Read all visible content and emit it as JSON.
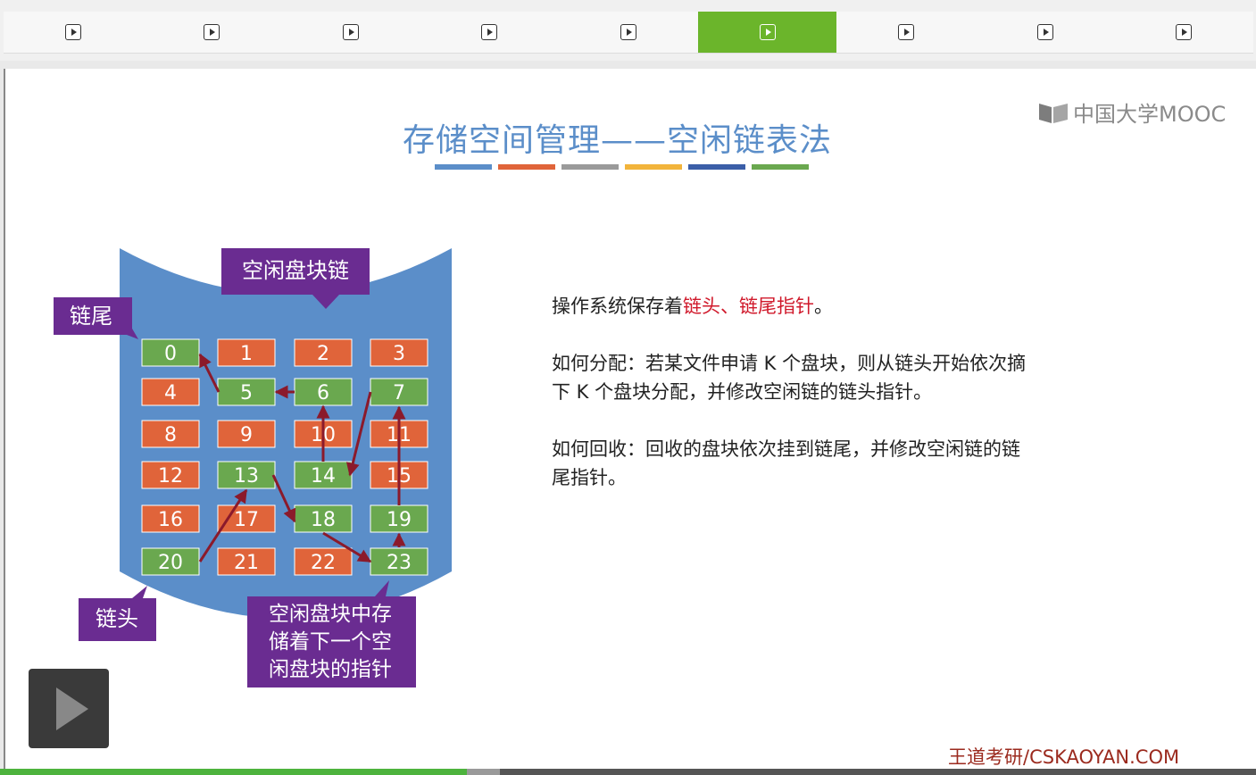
{
  "tabs": [
    {
      "icon": "play-icon",
      "active": false
    },
    {
      "icon": "play-icon",
      "active": false
    },
    {
      "icon": "play-icon",
      "active": false
    },
    {
      "icon": "play-icon",
      "active": false
    },
    {
      "icon": "play-icon",
      "active": false
    },
    {
      "icon": "play-icon",
      "active": true
    },
    {
      "icon": "play-icon",
      "active": false
    },
    {
      "icon": "play-icon",
      "active": false
    },
    {
      "icon": "play-icon",
      "active": false
    }
  ],
  "slide": {
    "title": "存储空间管理——空闲链表法",
    "logo_text": "中国大学MOOC",
    "underline_colors": [
      "#5b8ec9",
      "#e0643a",
      "#9a9a9a",
      "#f2b43b",
      "#3b5ea8",
      "#6aa84f"
    ],
    "diagram": {
      "callouts": {
        "chain_label": "空闲盘块链",
        "tail": "链尾",
        "head": "链头",
        "note": [
          "空闲盘块中存",
          "储着下一个空",
          "闲盘块的指针"
        ]
      },
      "free_blocks": [
        0,
        5,
        6,
        7,
        13,
        14,
        18,
        19,
        20,
        23
      ],
      "blocks": [
        0,
        1,
        2,
        3,
        4,
        5,
        6,
        7,
        8,
        9,
        10,
        11,
        12,
        13,
        14,
        15,
        16,
        17,
        18,
        19,
        20,
        21,
        22,
        23
      ],
      "colors": {
        "free": "#6aa84f",
        "used": "#e0643a",
        "cylinder": "#5b8ec9",
        "arrow": "#8b1a2b",
        "callout": "#6a2c91"
      }
    },
    "paragraphs": {
      "p1_prefix": "操作系统保存着",
      "p1_red": "链头、链尾指针",
      "p1_suffix": "。",
      "p2_line1": "如何分配：若某文件申请 K 个盘块，则从链头开始依次摘",
      "p2_line2": "下 K 个盘块分配，并修改空闲链的链头指针。",
      "p3_line1": "如何回收：回收的盘块依次挂到链尾，并修改空闲链的链",
      "p3_line2": "尾指针。"
    },
    "brand": "王道考研/CSKAOYAN.COM"
  },
  "player": {
    "icon": "play-icon"
  },
  "progress": {
    "played_fraction": 0.372,
    "buffered_end_fraction": 0.398
  }
}
